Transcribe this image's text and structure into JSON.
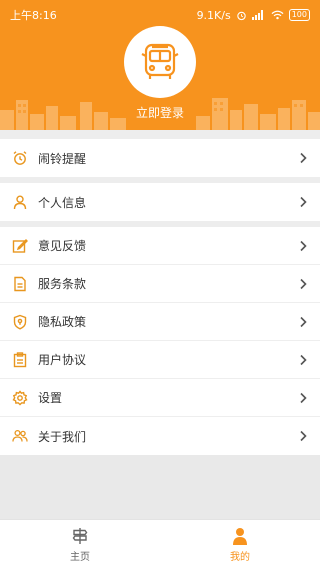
{
  "status_bar": {
    "time": "上午8:16",
    "network_speed": "9.1K/s",
    "battery": "100"
  },
  "profile": {
    "avatar_icon": "bus-icon",
    "login_label": "立即登录"
  },
  "menu_sections": [
    [
      {
        "label": "闹铃提醒",
        "icon": "alarm-clock-icon"
      }
    ],
    [
      {
        "label": "个人信息",
        "icon": "person-icon"
      }
    ],
    [
      {
        "label": "意见反馈",
        "icon": "feedback-edit-icon"
      },
      {
        "label": "服务条款",
        "icon": "document-icon"
      },
      {
        "label": "隐私政策",
        "icon": "shield-icon"
      },
      {
        "label": "用户协议",
        "icon": "agreement-icon"
      },
      {
        "label": "设置",
        "icon": "gear-icon"
      },
      {
        "label": "关于我们",
        "icon": "users-icon"
      }
    ]
  ],
  "tabs": [
    {
      "label": "主页",
      "icon": "signpost-icon",
      "active": false
    },
    {
      "label": "我的",
      "icon": "user-silhouette-icon",
      "active": true
    }
  ],
  "colors": {
    "accent": "#f7931e",
    "text": "#333333",
    "inactive_tab": "#666666",
    "icon_orange": "#e8961e"
  }
}
